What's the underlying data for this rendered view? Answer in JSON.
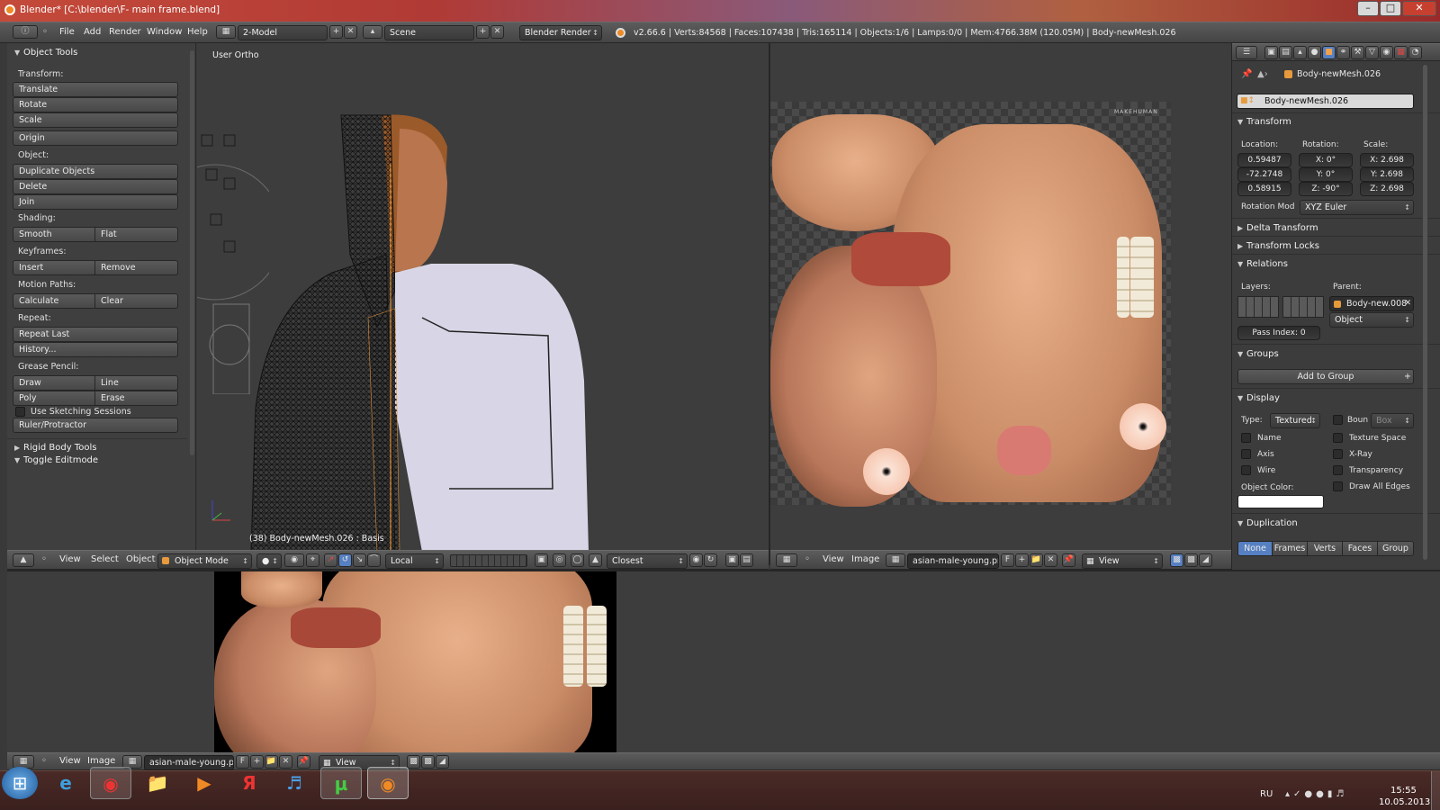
{
  "window": {
    "title": "Blender* [C:\\blender\\F- main frame.blend]",
    "controls": [
      "–",
      "□",
      "✕"
    ]
  },
  "menubar": {
    "menus": [
      "File",
      "Add",
      "Render",
      "Window",
      "Help"
    ],
    "layout": "2-Model",
    "scene": "Scene",
    "engine": "Blender Render",
    "stats": "v2.66.6 | Verts:84568 | Faces:107438 | Tris:165114 | Objects:1/6 | Lamps:0/0 | Mem:4766.38M (120.05M) | Body-newMesh.026"
  },
  "toolshelf": {
    "title": "Object Tools",
    "transform_label": "Transform:",
    "translate": "Translate",
    "rotate": "Rotate",
    "scale": "Scale",
    "origin": "Origin",
    "object_label": "Object:",
    "duplicate": "Duplicate Objects",
    "delete": "Delete",
    "join": "Join",
    "shading_label": "Shading:",
    "smooth": "Smooth",
    "flat": "Flat",
    "keyframes_label": "Keyframes:",
    "insert": "Insert",
    "remove": "Remove",
    "motion_label": "Motion Paths:",
    "calculate": "Calculate",
    "clear": "Clear",
    "repeat_label": "Repeat:",
    "repeat_last": "Repeat Last",
    "history": "History...",
    "grease_label": "Grease Pencil:",
    "draw": "Draw",
    "line": "Line",
    "poly": "Poly",
    "erase": "Erase",
    "sketching": "Use Sketching Sessions",
    "ruler": "Ruler/Protractor",
    "rigid": "Rigid Body Tools",
    "toggle_edit": "Toggle Editmode"
  },
  "viewport": {
    "view_name": "User Ortho",
    "status": "(38) Body-newMesh.026 : Basis"
  },
  "view3d_header": {
    "view": "View",
    "select": "Select",
    "object": "Object",
    "mode": "Object Mode",
    "orientation": "Local",
    "snap": "Closest"
  },
  "uv_header": {
    "view": "View",
    "image": "Image",
    "image_name": "asian-male-young.png",
    "f": "F",
    "display": "View"
  },
  "image_editor_header": {
    "view": "View",
    "image": "Image",
    "image_name": "asian-male-young.png",
    "f": "F",
    "display": "View"
  },
  "texture": {
    "logo": "MAKEHUMAN"
  },
  "properties": {
    "object_path": "Body-newMesh.026",
    "object_name": "Body-newMesh.026",
    "transform": {
      "title": "Transform",
      "location_label": "Location:",
      "rotation_label": "Rotation:",
      "scale_label": "Scale:",
      "location": [
        "0.59487",
        "-72.2748",
        "0.58915"
      ],
      "rotation": [
        "X: 0°",
        "Y: 0°",
        "Z: -90°"
      ],
      "scale": [
        "X: 2.698",
        "Y: 2.698",
        "Z: 2.698"
      ],
      "rotation_mode_label": "Rotation Mod",
      "rotation_mode": "XYZ Euler"
    },
    "delta": "Delta Transform",
    "locks": "Transform Locks",
    "relations": {
      "title": "Relations",
      "layers_label": "Layers:",
      "parent_label": "Parent:",
      "parent": "Body-new.008",
      "parent_type": "Object",
      "pass_index": "Pass Index: 0"
    },
    "groups": {
      "title": "Groups",
      "add": "Add to Group"
    },
    "display": {
      "title": "Display",
      "type_label": "Type:",
      "type": "Textured",
      "bounds": "Boun",
      "bounds_type": "Box",
      "name": "Name",
      "texture_space": "Texture Space",
      "axis": "Axis",
      "xray": "X-Ray",
      "wire": "Wire",
      "transparency": "Transparency",
      "object_color": "Object Color:",
      "draw_all_edges": "Draw All Edges"
    },
    "duplication": {
      "title": "Duplication",
      "options": [
        "None",
        "Frames",
        "Verts",
        "Faces",
        "Group"
      ]
    }
  },
  "taskbar": {
    "lang": "RU",
    "time": "15:55",
    "date": "10.05.2013"
  },
  "colors": {
    "accent": "#5680c2",
    "frame_orange": "#e79a3c",
    "panel": "#393939",
    "viewport": "#3d3d3d"
  }
}
